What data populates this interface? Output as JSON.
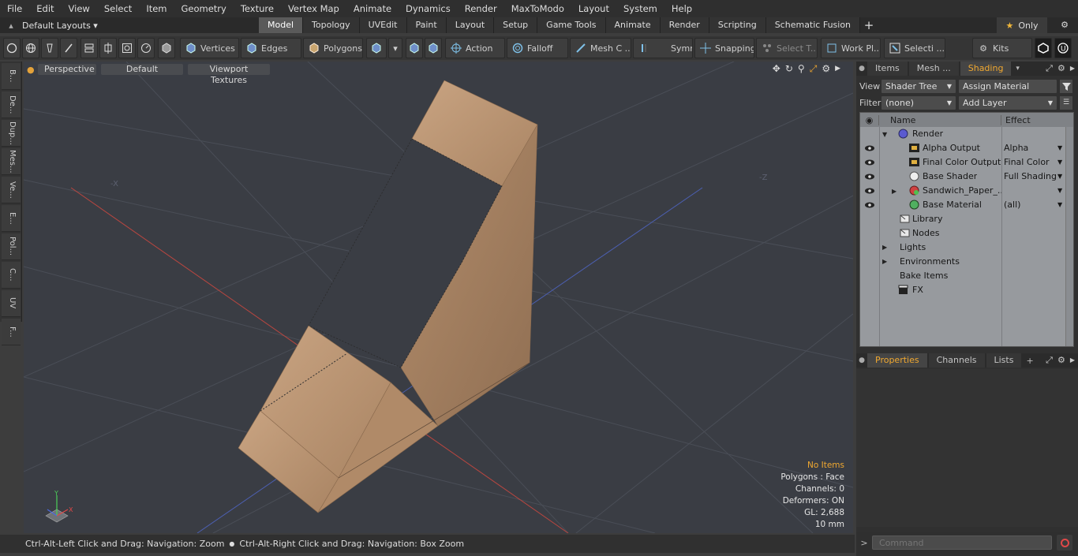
{
  "menu": [
    "File",
    "Edit",
    "View",
    "Select",
    "Item",
    "Geometry",
    "Texture",
    "Vertex Map",
    "Animate",
    "Dynamics",
    "Render",
    "MaxToModo",
    "Layout",
    "System",
    "Help"
  ],
  "layouts": {
    "label": "Default Layouts ▾"
  },
  "tabs": [
    {
      "label": "Model",
      "active": true
    },
    {
      "label": "Topology"
    },
    {
      "label": "UVEdit"
    },
    {
      "label": "Paint"
    },
    {
      "label": "Layout"
    },
    {
      "label": "Setup"
    },
    {
      "label": "Game Tools"
    },
    {
      "label": "Animate"
    },
    {
      "label": "Render"
    },
    {
      "label": "Scripting"
    },
    {
      "label": "Schematic Fusion"
    }
  ],
  "only_label": "Only",
  "toolbar": {
    "vertices": "Vertices",
    "edges": "Edges",
    "polygons": "Polygons",
    "action": "Action",
    "falloff": "Falloff",
    "mesh": "Mesh C ...",
    "symm": "Symm ...",
    "snapping": "Snapping",
    "select_t": "Select T...",
    "work_plane": "Work Pl...",
    "selecti": "Selecti ...",
    "kits": "Kits"
  },
  "left_tabs": [
    "B...",
    "De...",
    "Dup...",
    "Mes...",
    "Ve...",
    "E...",
    "Pol...",
    "C...",
    "UV",
    "F..."
  ],
  "viewport": {
    "perspective": "Perspective",
    "default": "Default",
    "viewport_textures": "Viewport Textures",
    "info": {
      "no_items": "No Items",
      "polygons": "Polygons : Face",
      "channels": "Channels: 0",
      "deformers": "Deformers: ON",
      "gl": "GL: 2,688",
      "unit": "10 mm"
    },
    "axis_neg_x": "-X",
    "axis_neg_z": "-Z"
  },
  "status": {
    "left": "Ctrl-Alt-Left Click and Drag: Navigation: Zoom",
    "right": "Ctrl-Alt-Right Click and Drag: Navigation: Box Zoom"
  },
  "panel": {
    "tabs": [
      "Items",
      "Mesh ...",
      "Shading"
    ],
    "view_label": "View",
    "view_value": "Shader Tree",
    "assign": "Assign Material",
    "filter_label": "Filter",
    "filter_value": "(none)",
    "add_layer": "Add Layer",
    "col_name": "Name",
    "col_effect": "Effect",
    "rows": [
      {
        "name": "Render",
        "effect": ""
      },
      {
        "name": "Alpha Output",
        "effect": "Alpha"
      },
      {
        "name": "Final Color Output",
        "effect": "Final Color"
      },
      {
        "name": "Base Shader",
        "effect": "Full Shading"
      },
      {
        "name": "Sandwich_Paper_...",
        "effect": ""
      },
      {
        "name": "Base Material",
        "effect": "(all)"
      },
      {
        "name": "Library",
        "effect": ""
      },
      {
        "name": "Nodes",
        "effect": ""
      },
      {
        "name": "Lights",
        "effect": ""
      },
      {
        "name": "Environments",
        "effect": ""
      },
      {
        "name": "Bake Items",
        "effect": ""
      },
      {
        "name": "FX",
        "effect": ""
      }
    ],
    "bottom_tabs": [
      "Properties",
      "Channels",
      "Lists"
    ],
    "command_placeholder": "Command"
  },
  "colors": {
    "accent": "#f0a830",
    "viewport_bg": "#3a3d44",
    "cardboard": "#c09a78"
  }
}
